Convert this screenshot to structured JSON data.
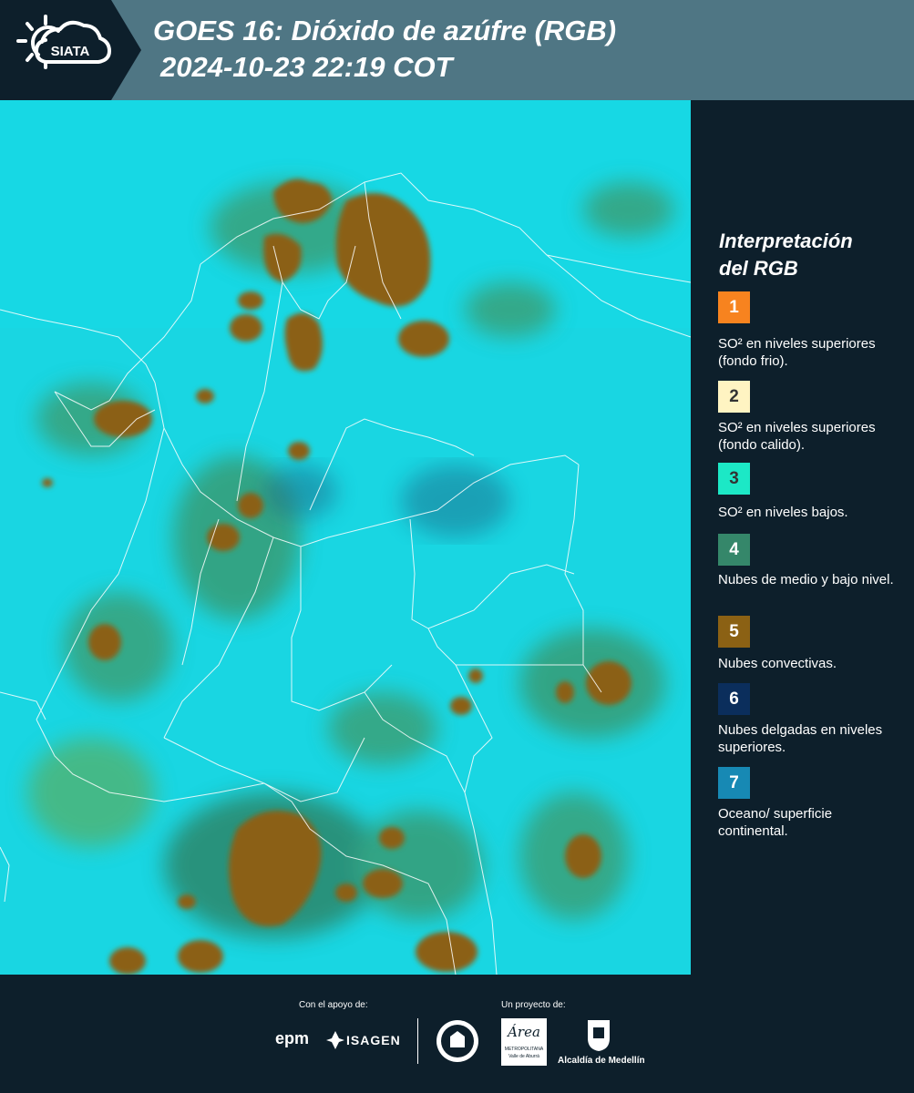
{
  "header": {
    "logo_text": "SIATA",
    "title_line1": "GOES 16: Dióxido de azúfre (RGB)",
    "title_line2": "2024-10-23 22:19 COT"
  },
  "legend": {
    "title_line1": "Interpretación",
    "title_line2": "del RGB",
    "items": [
      {
        "num": "1",
        "color": "#f7831f",
        "num_color": "#ffffff",
        "desc": "SO² en niveles superiores (fondo frio)."
      },
      {
        "num": "2",
        "color": "#fff4c2",
        "num_color": "#333333",
        "desc": "SO² en niveles superiores (fondo calido)."
      },
      {
        "num": "3",
        "color": "#1ce8c6",
        "num_color": "#333333",
        "desc": "SO² en niveles bajos."
      },
      {
        "num": "4",
        "color": "#35876a",
        "num_color": "#ffffff",
        "desc": "Nubes de medio y bajo nivel."
      },
      {
        "num": "5",
        "color": "#8b6114",
        "num_color": "#ffffff",
        "desc": "Nubes convectivas."
      },
      {
        "num": "6",
        "color": "#0b2e5c",
        "num_color": "#ffffff",
        "desc": "Nubes delgadas en niveles superiores."
      },
      {
        "num": "7",
        "color": "#1789b4",
        "num_color": "#ffffff",
        "desc": "Oceano/ superficie continental."
      }
    ]
  },
  "footer": {
    "support_label": "Con el apoyo de:",
    "project_label": "Un proyecto de:",
    "epm": "epm",
    "isagen": "ISAGEN",
    "area_name": "Área",
    "area_sub": "METROPOLITANA",
    "area_sub2": "Valle de Aburrá",
    "alcaldia": "Alcaldía de Medellín"
  },
  "colors": {
    "header_bg": "#4f7684",
    "panel_bg": "#0d1f2b",
    "map_base": "#19d6e2",
    "convective": "#8b6114",
    "mid_low_cloud": "#35876a"
  }
}
